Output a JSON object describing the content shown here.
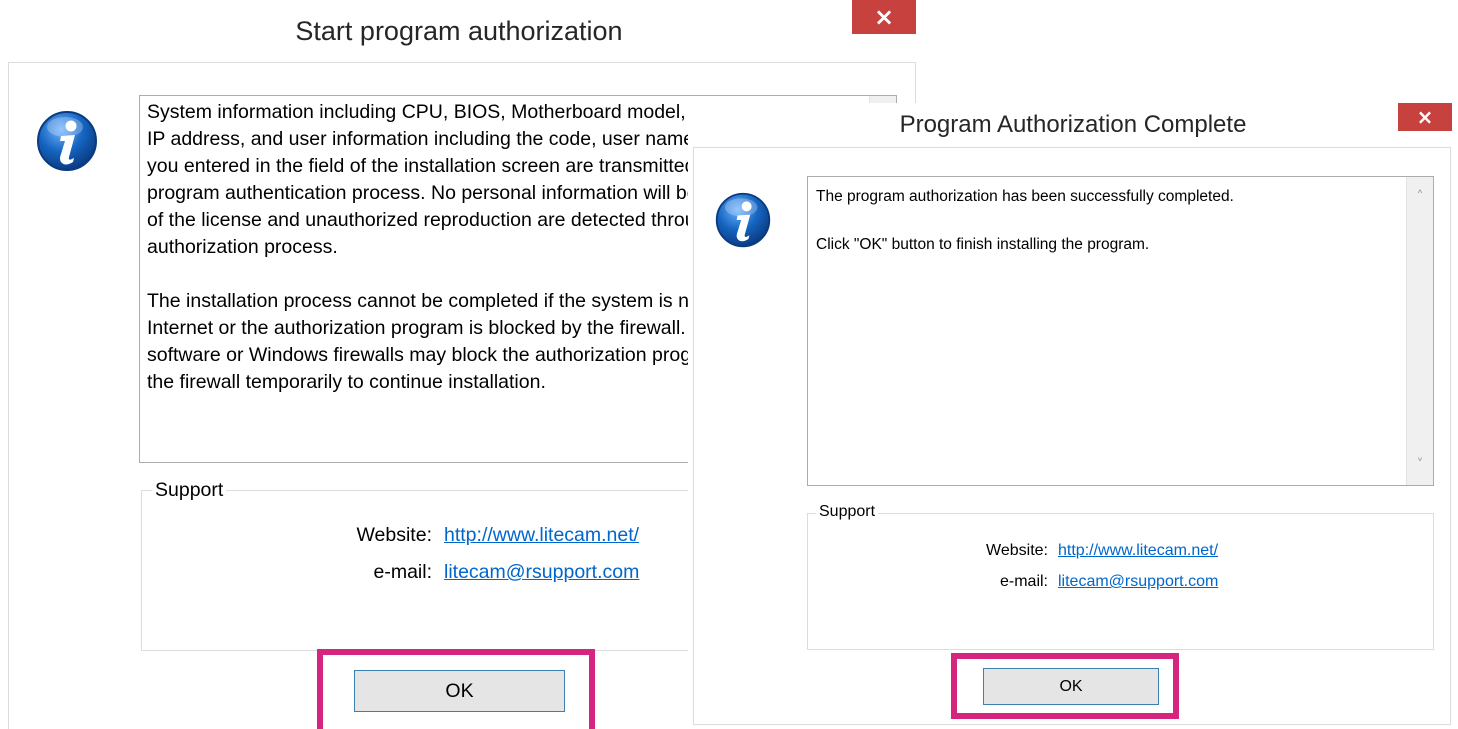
{
  "colors": {
    "close_button": "#c7423f",
    "link": "#0066cc",
    "highlight": "#d6257f",
    "button_border": "#3c7fb1",
    "info_icon": "#1565c0"
  },
  "dialog1": {
    "title": "Start program authorization",
    "close_glyph": "×",
    "icon": "info-icon",
    "message_paragraphs": [
      "System information including CPU, BIOS, Motherboard model, graphics card and IP address, and user information including the code, user name and e-mail address you entered in the field of the installation screen are transmitted to initiate the program authentication process. No personal information will be saved. Excess use of the license and unauthorized reproduction are detected through the authorization process.",
      "The installation process cannot be completed if the system is not connected to the Internet or the authorization program is blocked by the firewall. Some firewall software or Windows firewalls may block the authorization program, please disable the firewall temporarily to continue installation."
    ],
    "support": {
      "legend": "Support",
      "website_label": "Website:",
      "website_value": "http://www.litecam.net/",
      "email_label": "e-mail:",
      "email_value": "litecam@rsupport.com"
    },
    "ok_label": "OK"
  },
  "dialog2": {
    "title": "Program Authorization Complete",
    "close_glyph": "×",
    "icon": "info-icon",
    "message_lines": [
      "The program authorization has been successfully completed.",
      "Click \"OK\" button to finish installing the program."
    ],
    "scroll_up": "˄",
    "scroll_down": "˅",
    "support": {
      "legend": "Support",
      "website_label": "Website:",
      "website_value": "http://www.litecam.net/",
      "email_label": "e-mail:",
      "email_value": "litecam@rsupport.com"
    },
    "ok_label": "OK"
  }
}
